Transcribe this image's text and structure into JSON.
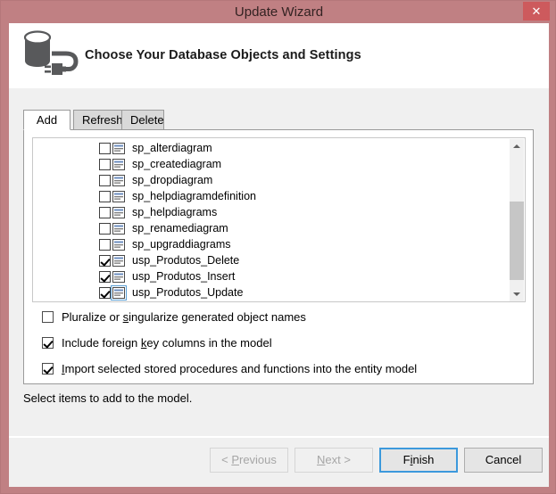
{
  "window": {
    "title": "Update Wizard",
    "close_label": "✕",
    "titlebar_color": "#c08083",
    "close_button_color": "#cd5a5d"
  },
  "header": {
    "heading": "Choose Your Database Objects and Settings",
    "icon": "database-plug-icon"
  },
  "tabs": [
    {
      "label": "Add",
      "active": true
    },
    {
      "label": "Refresh",
      "active": false
    },
    {
      "label": "Delete",
      "active": false
    }
  ],
  "list": {
    "items": [
      {
        "label": "sp_alterdiagram",
        "checked": false,
        "focused": false
      },
      {
        "label": "sp_creatediagram",
        "checked": false,
        "focused": false
      },
      {
        "label": "sp_dropdiagram",
        "checked": false,
        "focused": false
      },
      {
        "label": "sp_helpdiagramdefinition",
        "checked": false,
        "focused": false
      },
      {
        "label": "sp_helpdiagrams",
        "checked": false,
        "focused": false
      },
      {
        "label": "sp_renamediagram",
        "checked": false,
        "focused": false
      },
      {
        "label": "sp_upgraddiagrams",
        "checked": false,
        "focused": false
      },
      {
        "label": "usp_Produtos_Delete",
        "checked": true,
        "focused": false
      },
      {
        "label": "usp_Produtos_Insert",
        "checked": true,
        "focused": false
      },
      {
        "label": "usp_Produtos_Update",
        "checked": true,
        "focused": true
      }
    ],
    "scrollbar": {
      "up_arrow": "scroll-up-arrow",
      "down_arrow": "scroll-down-arrow"
    }
  },
  "options": [
    {
      "label_pre": "Pluralize or ",
      "accel": "s",
      "label_post": "ingularize generated object names",
      "checked": false
    },
    {
      "label_pre": "Include foreign ",
      "accel": "k",
      "label_post": "ey columns in the model",
      "checked": true
    },
    {
      "label_pre": "",
      "accel": "I",
      "label_post": "mport selected stored procedures and functions into the entity model",
      "checked": true
    }
  ],
  "status": {
    "text": "Select items to add to the model."
  },
  "buttons": {
    "previous": {
      "label_pre": "< ",
      "accel": "P",
      "label_post": "revious",
      "enabled": false
    },
    "next": {
      "label_pre": "",
      "accel": "N",
      "label_post": "ext >",
      "enabled": false
    },
    "finish": {
      "label_pre": "F",
      "accel": "i",
      "label_post": "nish",
      "enabled": true,
      "focused": true
    },
    "cancel": {
      "label_pre": "Cancel",
      "accel": "",
      "label_post": "",
      "enabled": true
    }
  }
}
